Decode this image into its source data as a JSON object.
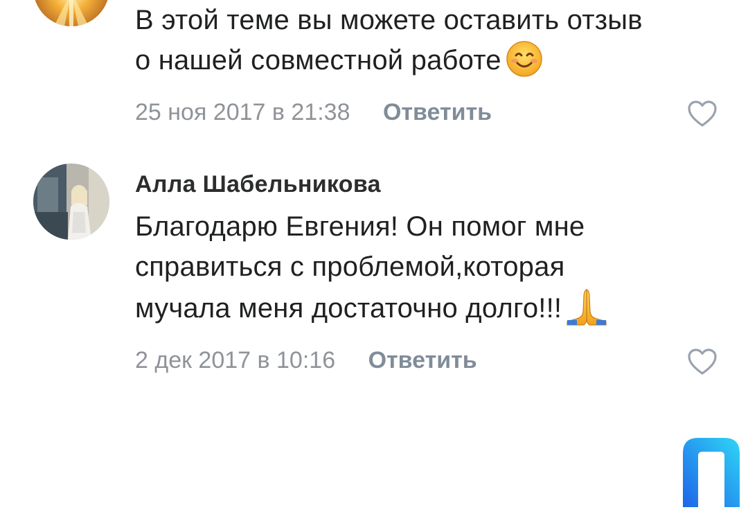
{
  "comments": [
    {
      "author": "",
      "text": "В этой теме вы можете оставить отзыв\nо нашей совместной работе",
      "emoji": "smiling-face-icon",
      "date": "25 ноя 2017 в 21:38",
      "reply_label": "Ответить",
      "like_icon": "heart-icon"
    },
    {
      "author": "Алла Шабельникова",
      "text": "Благодарю Евгения! Он помог мне\nсправиться с проблемой,которая\nмучала меня достаточно долго!!!",
      "emoji": "folded-hands-icon",
      "date": "2 дек 2017 в 10:16",
      "reply_label": "Ответить",
      "like_icon": "heart-icon"
    }
  ],
  "colors": {
    "meta_text": "#8f9398",
    "reply_text": "#818c99",
    "logo_gradient_start": "#1e63e9",
    "logo_gradient_end": "#2fd6f5"
  },
  "watermark": {
    "icon": "brand-logo-icon"
  }
}
